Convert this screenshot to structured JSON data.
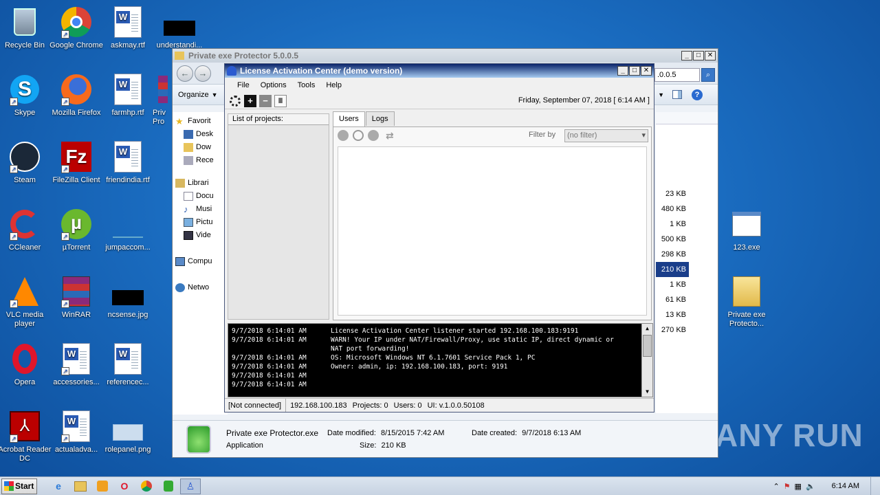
{
  "colors": {
    "desktop": "#1a6cc0",
    "lac_title": "#0a246a",
    "selection": "#1a3e8a",
    "log_bg": "#000000"
  },
  "desktop": {
    "icons": [
      {
        "label": "Recycle Bin",
        "icon": "recycle-bin-icon"
      },
      {
        "label": "Google Chrome",
        "icon": "chrome-icon"
      },
      {
        "label": "askmay.rtf",
        "icon": "word-doc-icon"
      },
      {
        "label": "understandi...",
        "icon": "image-thumbnail-icon"
      },
      {
        "label": "Skype",
        "icon": "skype-icon"
      },
      {
        "label": "Mozilla Firefox",
        "icon": "firefox-icon"
      },
      {
        "label": "farmhp.rtf",
        "icon": "word-doc-icon"
      },
      {
        "label": "Steam",
        "icon": "steam-icon"
      },
      {
        "label": "FileZilla Client",
        "icon": "filezilla-icon"
      },
      {
        "label": "friendindia.rtf",
        "icon": "word-doc-icon"
      },
      {
        "label": "CCleaner",
        "icon": "ccleaner-icon"
      },
      {
        "label": "µTorrent",
        "icon": "utorrent-icon"
      },
      {
        "label": "jumpaccom...",
        "icon": "image-thumbnail-icon"
      },
      {
        "label": "VLC media player",
        "icon": "vlc-icon"
      },
      {
        "label": "WinRAR",
        "icon": "winrar-icon"
      },
      {
        "label": "ncsense.jpg",
        "icon": "image-thumbnail-icon"
      },
      {
        "label": "Opera",
        "icon": "opera-icon"
      },
      {
        "label": "accessories...",
        "icon": "word-doc-icon"
      },
      {
        "label": "referencec...",
        "icon": "word-doc-icon"
      },
      {
        "label": "Acrobat Reader DC",
        "icon": "acrobat-icon"
      },
      {
        "label": "actualadva...",
        "icon": "word-doc-icon"
      },
      {
        "label": "rolepanel.png",
        "icon": "image-thumbnail-icon"
      },
      {
        "label": "123.exe",
        "icon": "exe-icon"
      },
      {
        "label": "Private exe Protecto...",
        "icon": "folder-icon"
      }
    ],
    "partial_label": "Priv Pro"
  },
  "explorer": {
    "title": "Private exe Protector 5.0.0.5",
    "address_value": ".0.0.5",
    "organize_label": "Organize",
    "nav_items": [
      "Favorit",
      "Desk",
      "Dow",
      "Rece",
      "Librari",
      "Docu",
      "Musi",
      "Pictu",
      "Vide",
      "Compu",
      "Netwo"
    ],
    "sizes": [
      "23 KB",
      "480 KB",
      "1 KB",
      "500 KB",
      "298 KB",
      "210 KB",
      "1 KB",
      "61 KB",
      "13 KB",
      "270 KB"
    ],
    "selected_size_index": 5,
    "details": {
      "name": "Private exe Protector.exe",
      "type": "Application",
      "modified_label": "Date modified:",
      "modified_value": "8/15/2015 7:42 AM",
      "created_label": "Date created:",
      "created_value": "9/7/2018 6:13 AM",
      "size_label": "Size:",
      "size_value": "210 KB"
    }
  },
  "lac": {
    "title": "License Activation Center (demo version)",
    "menu": [
      "File",
      "Options",
      "Tools",
      "Help"
    ],
    "datetime": "Friday, September 07, 2018  [ 6:14 AM ]",
    "projects_header": "List of projects:",
    "tabs": [
      "Users",
      "Logs"
    ],
    "filter_label": "Filter by",
    "filter_value": "(no filter)",
    "log": [
      {
        "ts": "9/7/2018 6:14:01 AM",
        "msg": "License Activation Center listener started 192.168.100.183:9191"
      },
      {
        "ts": "9/7/2018 6:14:01 AM",
        "msg": "WARN! Your IP under NAT/Firewall/Proxy, use static IP, direct dynamic or"
      },
      {
        "ts": "",
        "msg": "NAT port forwarding!"
      },
      {
        "ts": "9/7/2018 6:14:01 AM",
        "msg": "OS: Microsoft Windows NT 6.1.7601 Service Pack 1, PC"
      },
      {
        "ts": "9/7/2018 6:14:01 AM",
        "msg": "Owner: admin, ip: 192.168.100.183, port: 9191"
      },
      {
        "ts": "9/7/2018 6:14:01 AM",
        "msg": ""
      },
      {
        "ts": "9/7/2018 6:14:01 AM",
        "msg": ""
      }
    ],
    "status": {
      "connection": "[Not connected]",
      "ip": "192.168.100.183",
      "projects": "Projects: 0",
      "users": "Users: 0",
      "ui": "UI: v.1.0.0.50108"
    }
  },
  "taskbar": {
    "start_label": "Start",
    "clock": "6:14 AM"
  },
  "watermark": "ANY RUN"
}
